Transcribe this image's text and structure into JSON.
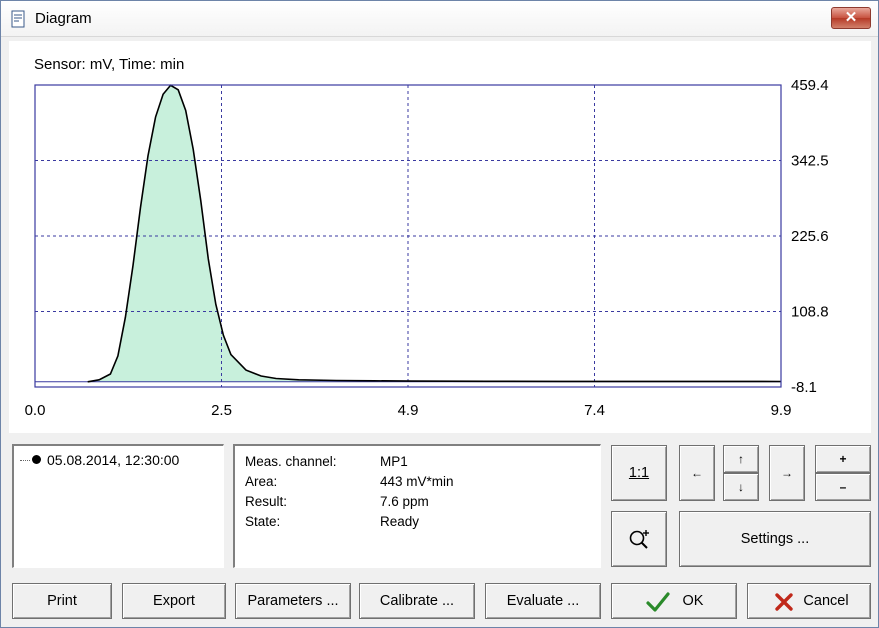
{
  "window": {
    "title": "Diagram",
    "close_icon": "close-icon"
  },
  "chart_data": {
    "type": "area",
    "header_label": "Sensor:  mV,   Time:  min",
    "x_ticks": [
      "0.0",
      "2.5",
      "4.9",
      "7.4",
      "9.9"
    ],
    "y_ticks": [
      "459.4",
      "342.5",
      "225.6",
      "108.8",
      "-8.1"
    ],
    "xlim": [
      0.0,
      9.9
    ],
    "ylim": [
      -8.1,
      459.4
    ],
    "grid": "dashed",
    "fill_color": "#c8f0dc",
    "line_color": "#000000",
    "frame_color": "#3a3aa0",
    "series": [
      {
        "x": [
          0.7,
          0.85,
          1.0,
          1.1,
          1.2,
          1.3,
          1.4,
          1.5,
          1.6,
          1.7,
          1.8,
          1.9,
          2.0,
          2.1,
          2.2,
          2.3,
          2.4,
          2.5,
          2.6,
          2.8,
          3.0,
          3.2,
          3.5,
          4.0,
          4.5,
          5.0,
          6.0,
          7.0,
          8.0,
          9.0,
          9.9
        ],
        "y": [
          0,
          3,
          12,
          40,
          100,
          180,
          270,
          350,
          410,
          445,
          459,
          452,
          420,
          360,
          280,
          190,
          120,
          72,
          42,
          18,
          9,
          5,
          3,
          2,
          1.5,
          1,
          0.8,
          0.6,
          0.5,
          0.5,
          0.4
        ]
      }
    ]
  },
  "history": {
    "items": [
      "05.08.2014, 12:30:00"
    ]
  },
  "info": {
    "rows": [
      {
        "key": "Meas. channel:",
        "value": "MP1"
      },
      {
        "key": "Area:",
        "value": "443 mV*min"
      },
      {
        "key": "Result:",
        "value": "7.6 ppm"
      },
      {
        "key": "State:",
        "value": "Ready"
      }
    ]
  },
  "controls": {
    "one_to_one": "1:1",
    "left": "←",
    "up": "↑",
    "down": "↓",
    "right": "→",
    "plus": "+",
    "minus": "–",
    "zoom_icon": "zoom-in-icon",
    "settings": "Settings ..."
  },
  "buttons": {
    "print": "Print",
    "export": "Export",
    "parameters": "Parameters ...",
    "calibrate": "Calibrate ...",
    "evaluate": "Evaluate ...",
    "ok": "OK",
    "cancel": "Cancel"
  }
}
